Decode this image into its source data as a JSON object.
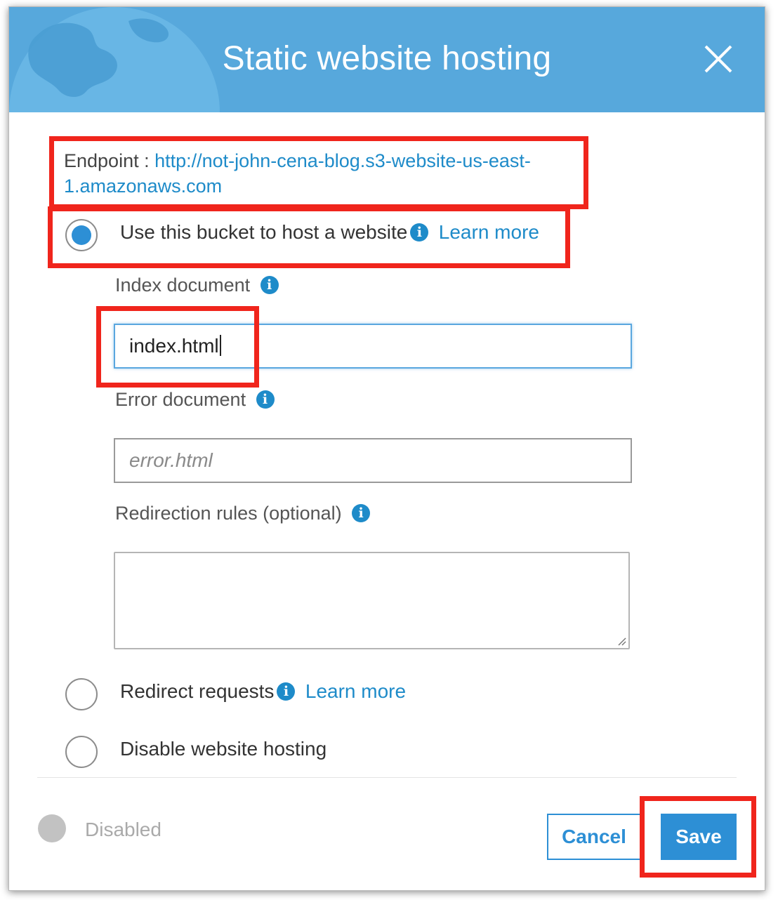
{
  "dialog": {
    "title": "Static website hosting",
    "endpoint_label": "Endpoint :",
    "endpoint_url_line1": "http://not-john-cena-blog.s3-website-us-east-",
    "endpoint_url_line2": "1.amazonaws.com"
  },
  "options": {
    "host_website": {
      "label": "Use this bucket to host a website",
      "learn_more": "Learn more",
      "selected": true
    },
    "redirect": {
      "label": "Redirect requests",
      "learn_more": "Learn more",
      "selected": false
    },
    "disable": {
      "label": "Disable website hosting",
      "selected": false
    }
  },
  "fields": {
    "index_document": {
      "label": "Index document",
      "value": "index.html"
    },
    "error_document": {
      "label": "Error document",
      "value": "",
      "placeholder": "error.html"
    },
    "redirection_rules": {
      "label": "Redirection rules (optional)",
      "value": ""
    }
  },
  "footer": {
    "status_label": "Disabled",
    "cancel_label": "Cancel",
    "save_label": "Save"
  },
  "icons": {
    "info": "info-icon",
    "close": "close-icon",
    "globe": "globe-graphic"
  },
  "colors": {
    "header": "#57a8dc",
    "accent": "#2d8fd5",
    "link": "#1e8bc9",
    "highlight": "#f0251c"
  }
}
